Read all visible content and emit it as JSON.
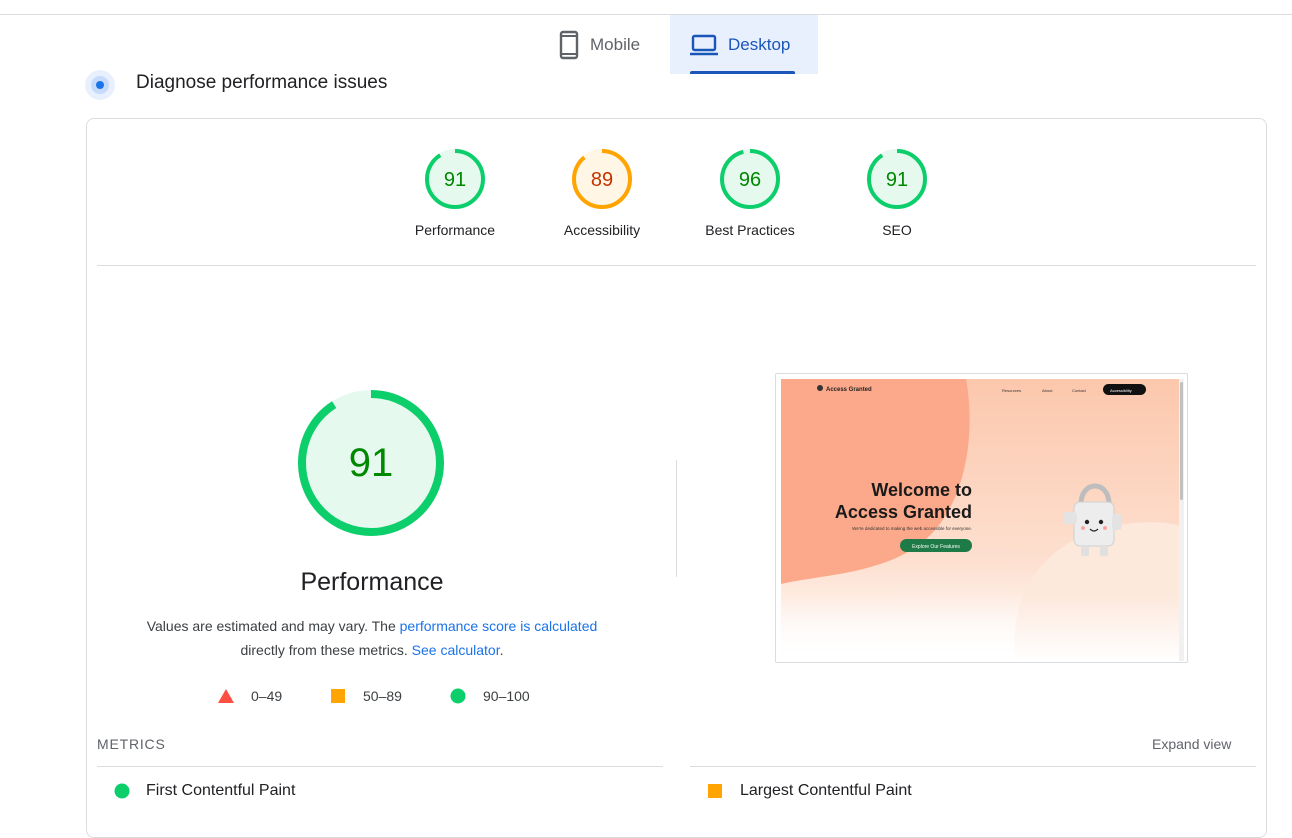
{
  "tabs": {
    "mobile": "Mobile",
    "desktop": "Desktop",
    "selected": "Desktop"
  },
  "section_title": "Diagnose performance issues",
  "scores": [
    {
      "value": "91",
      "label": "Performance",
      "status": "pass",
      "color": "#0cce6b"
    },
    {
      "value": "89",
      "label": "Accessibility",
      "status": "average",
      "color": "#ffa400"
    },
    {
      "value": "96",
      "label": "Best Practices",
      "status": "pass",
      "color": "#0cce6b"
    },
    {
      "value": "91",
      "label": "SEO",
      "status": "pass",
      "color": "#0cce6b"
    }
  ],
  "main_gauge": {
    "value": "91",
    "fraction": 0.91,
    "color": "#0cce6b"
  },
  "performance": {
    "title": "Performance",
    "desc_prefix": "Values are estimated and may vary. The ",
    "desc_link1": "performance score is calculated",
    "desc_middle": "directly from these metrics. ",
    "desc_link2": "See calculator",
    "desc_suffix": "."
  },
  "legend": [
    {
      "range": "0–49",
      "shape": "triangle",
      "color": "#ff4e42"
    },
    {
      "range": "50–89",
      "shape": "square",
      "color": "#ffa400"
    },
    {
      "range": "90–100",
      "shape": "circle",
      "color": "#0cce6b"
    }
  ],
  "screenshot": {
    "brand": "Access Granted",
    "nav": [
      "Resources",
      "About",
      "Contact"
    ],
    "nav_button": "Accessibility",
    "headline_line1": "Welcome to",
    "headline_line2": "Access Granted",
    "subtext": "We're dedicated to making the web accessible for everyone.",
    "cta": "Explore Our Features"
  },
  "metrics": {
    "label": "METRICS",
    "expand": "Expand view",
    "items": [
      {
        "name": "First Contentful Paint",
        "status": "pass",
        "color": "#0cce6b"
      },
      {
        "name": "Largest Contentful Paint",
        "status": "average",
        "color": "#ffa400"
      }
    ]
  }
}
